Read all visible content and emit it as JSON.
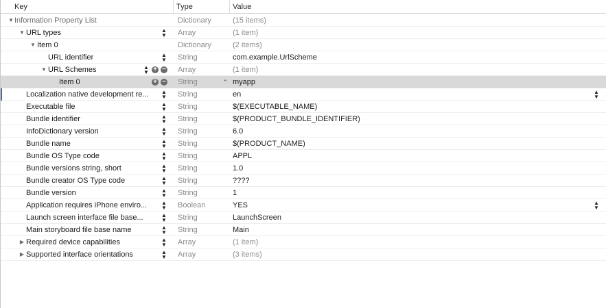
{
  "header": {
    "key_label": "Key",
    "type_label": "Type",
    "value_label": "Value"
  },
  "rows": [
    {
      "key": "Information Property List",
      "type": "Dictionary",
      "value": "(15 items)",
      "disclosure": "expanded"
    },
    {
      "key": "URL types",
      "type": "Array",
      "value": "(1 item)",
      "disclosure": "expanded"
    },
    {
      "key": "Item 0",
      "type": "Dictionary",
      "value": "(2 items)",
      "disclosure": "expanded"
    },
    {
      "key": "URL identifier",
      "type": "String",
      "value": "com.example.UrlScheme"
    },
    {
      "key": "URL Schemes",
      "type": "Array",
      "value": "(1 item)",
      "disclosure": "expanded"
    },
    {
      "key": "Item 0",
      "type": "String",
      "value": "myapp",
      "selected": true
    },
    {
      "key": "Localization native development re...",
      "type": "String",
      "value": "en"
    },
    {
      "key": "Executable file",
      "type": "String",
      "value": "$(EXECUTABLE_NAME)"
    },
    {
      "key": "Bundle identifier",
      "type": "String",
      "value": "$(PRODUCT_BUNDLE_IDENTIFIER)"
    },
    {
      "key": "InfoDictionary version",
      "type": "String",
      "value": "6.0"
    },
    {
      "key": "Bundle name",
      "type": "String",
      "value": "$(PRODUCT_NAME)"
    },
    {
      "key": "Bundle OS Type code",
      "type": "String",
      "value": "APPL"
    },
    {
      "key": "Bundle versions string, short",
      "type": "String",
      "value": "1.0"
    },
    {
      "key": "Bundle creator OS Type code",
      "type": "String",
      "value": "????"
    },
    {
      "key": "Bundle version",
      "type": "String",
      "value": "1"
    },
    {
      "key": "Application requires iPhone enviro...",
      "type": "Boolean",
      "value": "YES"
    },
    {
      "key": "Launch screen interface file base...",
      "type": "String",
      "value": "LaunchScreen"
    },
    {
      "key": "Main storyboard file base name",
      "type": "String",
      "value": "Main"
    },
    {
      "key": "Required device capabilities",
      "type": "Array",
      "value": "(1 item)",
      "disclosure": "collapsed"
    },
    {
      "key": "Supported interface orientations",
      "type": "Array",
      "value": "(3 items)",
      "disclosure": "collapsed"
    }
  ],
  "icons": {
    "expanded": "disclosure-triangle-expanded-icon",
    "collapsed": "disclosure-triangle-collapsed-icon",
    "stepper": "up-down-stepper-icon",
    "add": "add-circle-icon",
    "remove": "remove-circle-icon",
    "chevron": "up-down-chevron-icon"
  },
  "colors": {
    "selected_row": "#d9d9d9",
    "type_text": "#8a8a8a",
    "accent": "#3a6fc7"
  }
}
